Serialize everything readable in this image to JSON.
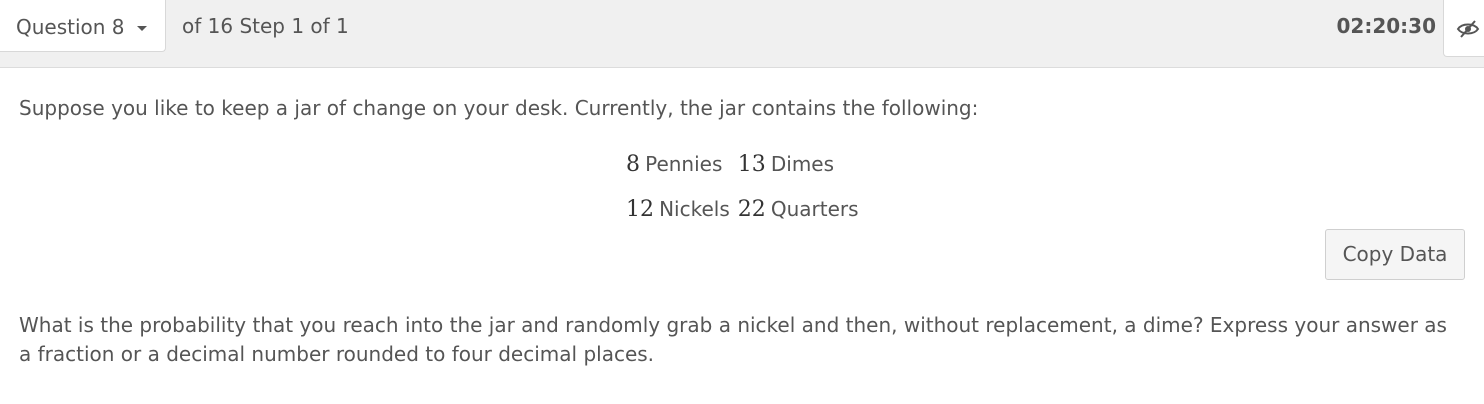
{
  "header": {
    "question_selector_label": "Question 8",
    "step_text": "of 16 Step 1 of 1",
    "timer": "02:20:30"
  },
  "problem": {
    "intro": "Suppose you like to keep a jar of change on your desk. Currently, the jar contains the following:",
    "coins": {
      "row1": [
        {
          "count": "8",
          "name": "Pennies"
        },
        {
          "count": "13",
          "name": "Dimes"
        }
      ],
      "row2": [
        {
          "count": "12",
          "name": "Nickels"
        },
        {
          "count": "22",
          "name": "Quarters"
        }
      ]
    },
    "copy_button_label": "Copy Data",
    "question": "What is the probability that you reach into the jar and randomly grab a nickel and then, without replacement, a dime? Express your answer as a fraction or a decimal number rounded to four decimal places."
  },
  "icons": {
    "question_dropdown": "chevron-down-icon",
    "visibility_toggle": "eye-slash-icon"
  }
}
